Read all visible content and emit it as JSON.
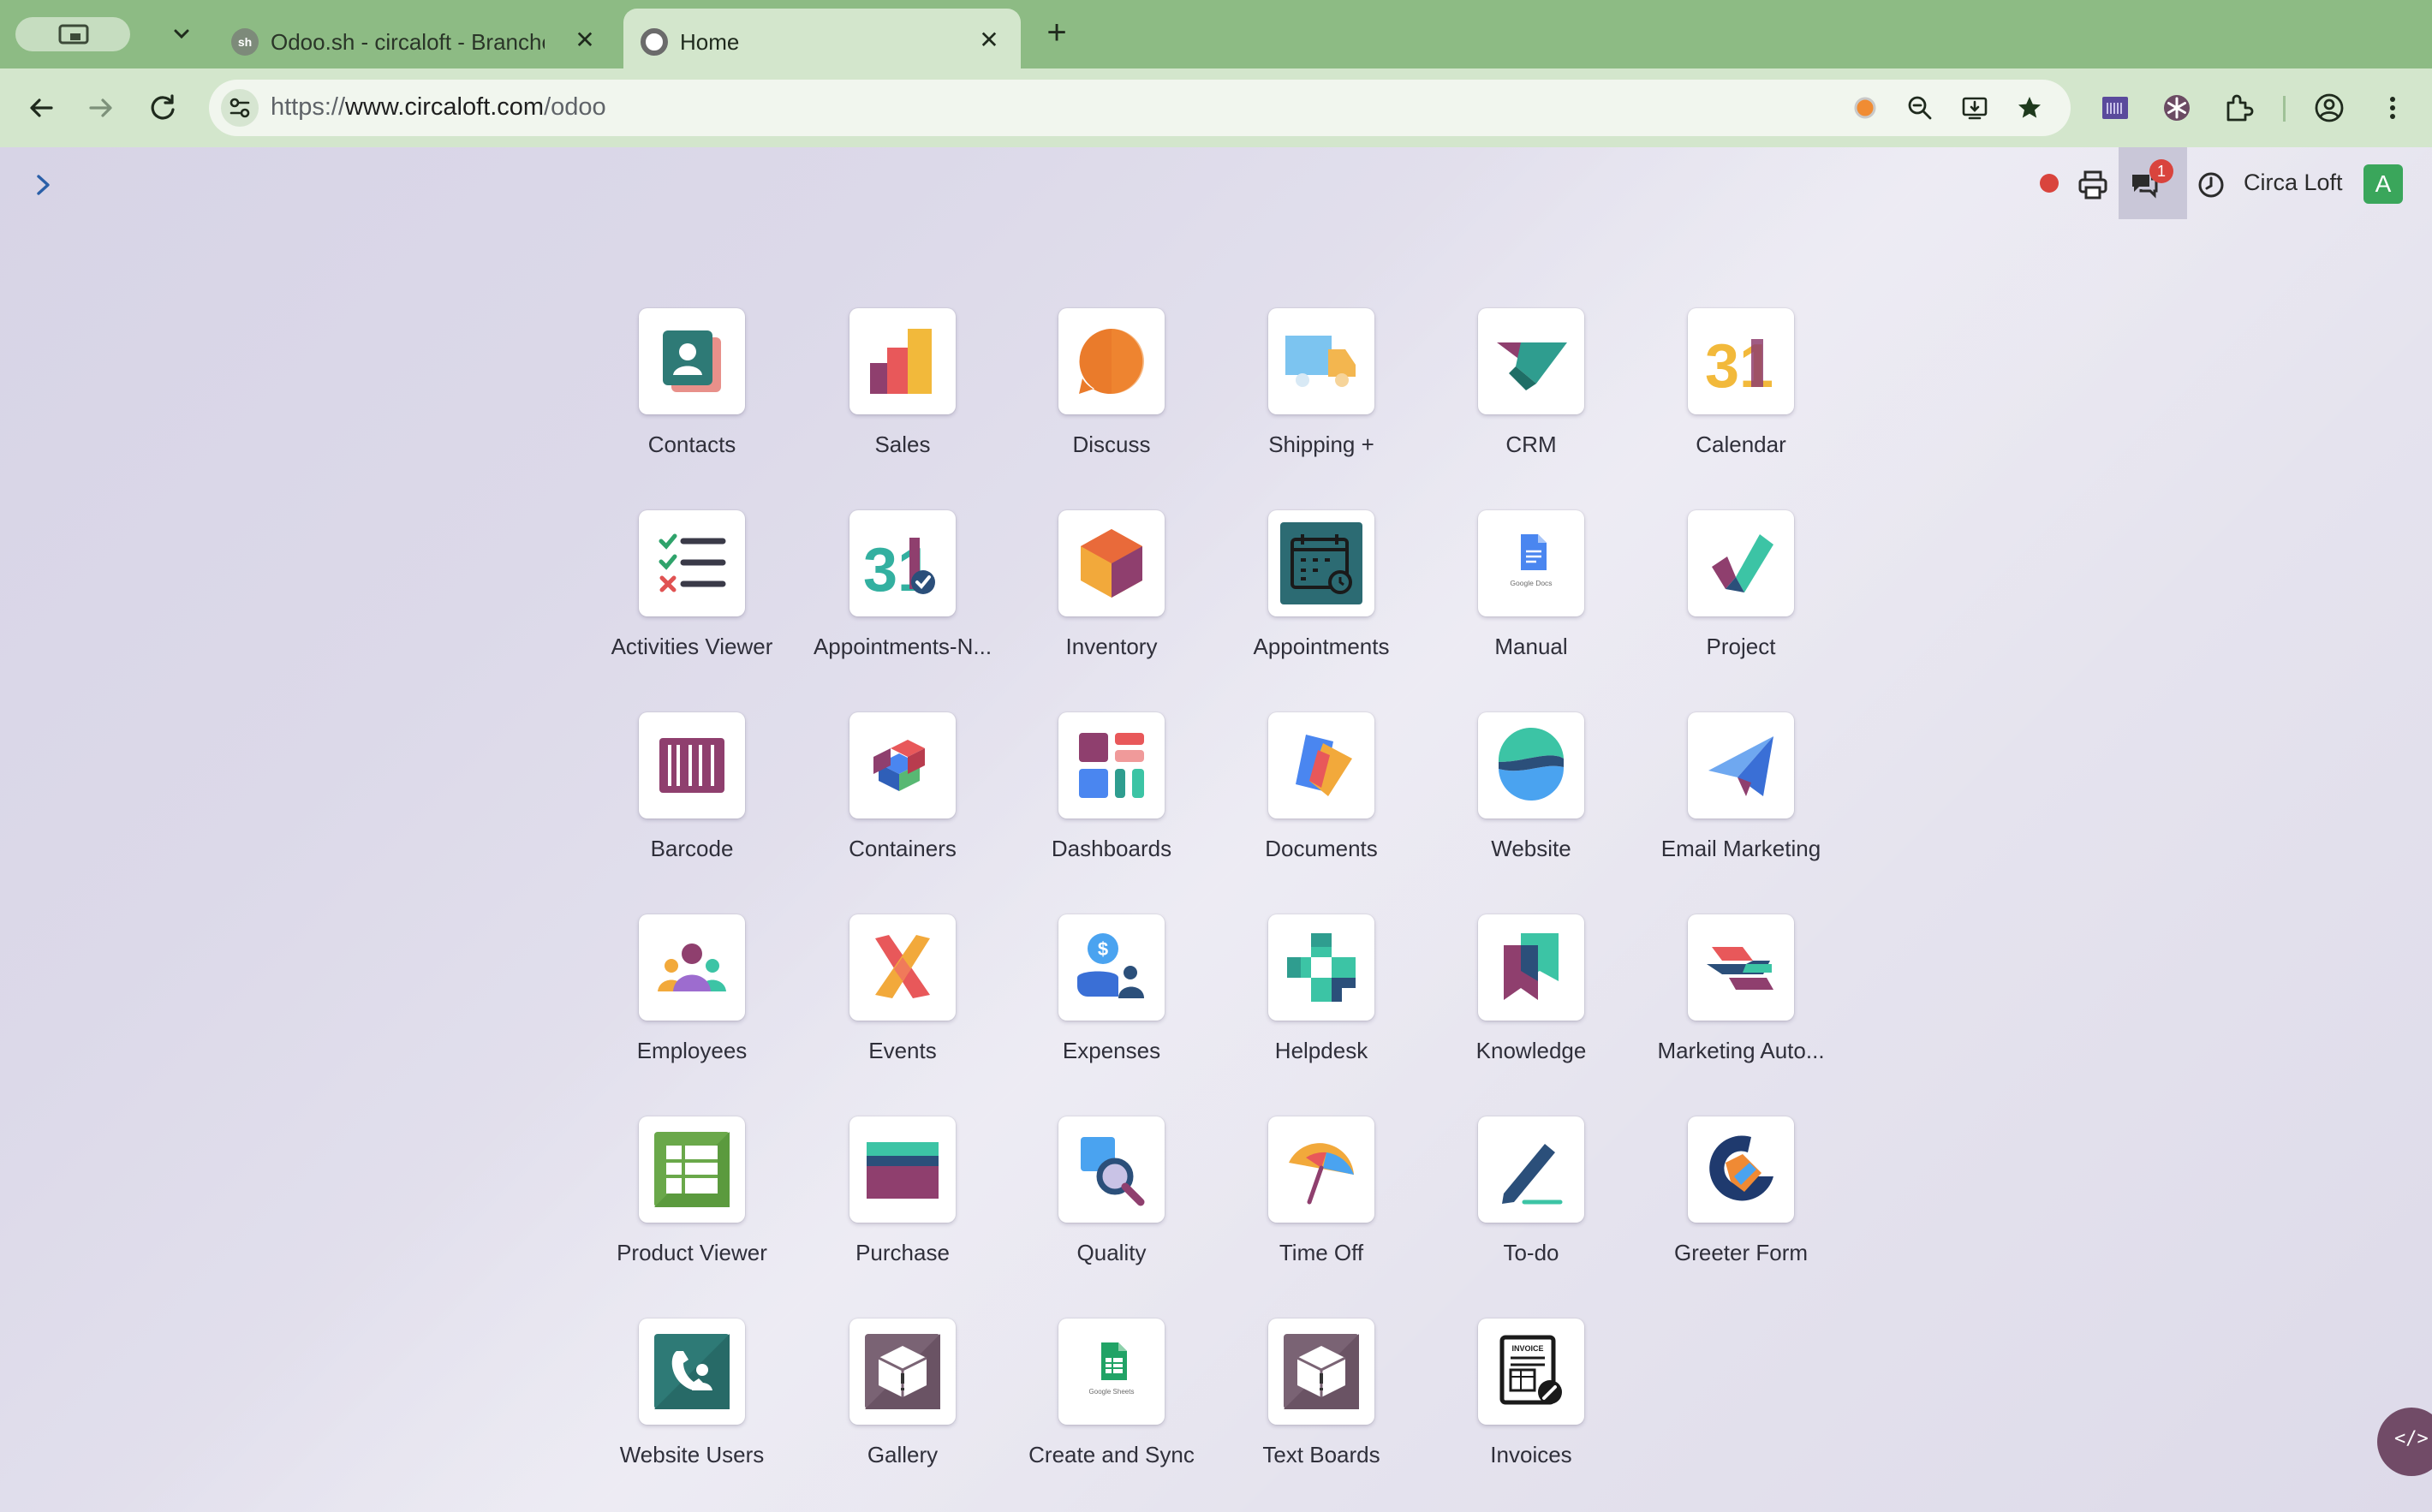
{
  "browser": {
    "tabs": [
      {
        "title": "Odoo.sh - circaloft - Branche",
        "favicon": "sh"
      },
      {
        "title": "Home",
        "favicon": "odoo-logo"
      }
    ],
    "url_scheme": "https://",
    "url_host": "www.circaloft.com",
    "url_path": "/odoo"
  },
  "systray": {
    "chat_badge": "1",
    "company": "Circa Loft",
    "avatar_initial": "A",
    "avatar_color": "#3aa65b"
  },
  "apps": [
    {
      "label": "Contacts",
      "icon": "contacts-icon"
    },
    {
      "label": "Sales",
      "icon": "sales-icon"
    },
    {
      "label": "Discuss",
      "icon": "discuss-icon"
    },
    {
      "label": "Shipping +",
      "icon": "shipping-icon"
    },
    {
      "label": "CRM",
      "icon": "crm-icon"
    },
    {
      "label": "Calendar",
      "icon": "calendar-icon"
    },
    {
      "label": "Activities Viewer",
      "icon": "activities-icon"
    },
    {
      "label": "Appointments-N...",
      "icon": "appointments-n-icon"
    },
    {
      "label": "Inventory",
      "icon": "inventory-icon"
    },
    {
      "label": "Appointments",
      "icon": "appointments-icon"
    },
    {
      "label": "Manual",
      "icon": "google-docs-icon"
    },
    {
      "label": "Project",
      "icon": "project-icon"
    },
    {
      "label": "Barcode",
      "icon": "barcode-icon"
    },
    {
      "label": "Containers",
      "icon": "containers-icon"
    },
    {
      "label": "Dashboards",
      "icon": "dashboards-icon"
    },
    {
      "label": "Documents",
      "icon": "documents-icon"
    },
    {
      "label": "Website",
      "icon": "website-icon"
    },
    {
      "label": "Email Marketing",
      "icon": "email-marketing-icon"
    },
    {
      "label": "Employees",
      "icon": "employees-icon"
    },
    {
      "label": "Events",
      "icon": "events-icon"
    },
    {
      "label": "Expenses",
      "icon": "expenses-icon"
    },
    {
      "label": "Helpdesk",
      "icon": "helpdesk-icon"
    },
    {
      "label": "Knowledge",
      "icon": "knowledge-icon"
    },
    {
      "label": "Marketing Auto...",
      "icon": "marketing-automation-icon"
    },
    {
      "label": "Product Viewer",
      "icon": "product-viewer-icon"
    },
    {
      "label": "Purchase",
      "icon": "purchase-icon"
    },
    {
      "label": "Quality",
      "icon": "quality-icon"
    },
    {
      "label": "Time Off",
      "icon": "time-off-icon"
    },
    {
      "label": "To-do",
      "icon": "todo-icon"
    },
    {
      "label": "Greeter Form",
      "icon": "greeter-form-icon"
    },
    {
      "label": "Website Users",
      "icon": "website-users-icon"
    },
    {
      "label": "Gallery",
      "icon": "gallery-icon"
    },
    {
      "label": "Create and Sync",
      "icon": "google-sheets-icon"
    },
    {
      "label": "Text Boards",
      "icon": "text-boards-icon"
    },
    {
      "label": "Invoices",
      "icon": "invoice-icon"
    }
  ],
  "small_text": {
    "google_docs": "Google Docs",
    "google_sheets": "Google Sheets",
    "invoice": "INVOICE",
    "calendar_number": "31",
    "expenses_symbol": "$"
  },
  "debug_fab": "</>"
}
